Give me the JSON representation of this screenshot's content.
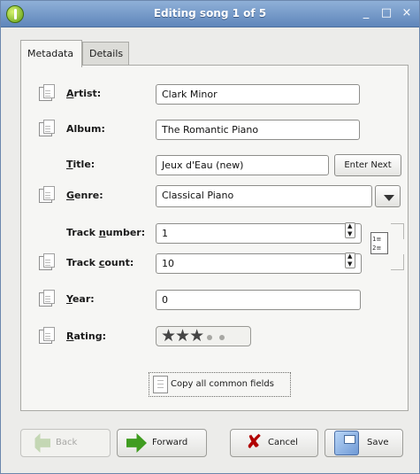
{
  "window": {
    "title": "Editing song 1 of 5",
    "buttons": [
      "_",
      "□",
      "×"
    ]
  },
  "tabs": [
    {
      "label": "Metadata",
      "active": true
    },
    {
      "label": "Details",
      "active": false
    }
  ],
  "fields": {
    "artist": {
      "label": "Artist:",
      "value": "Clark Minor"
    },
    "album": {
      "label": "Album:",
      "value": "The Romantic Piano"
    },
    "title": {
      "label": "Title:",
      "value": "Jeux d'Eau (new)",
      "button": "Enter Next"
    },
    "genre": {
      "label": "Genre:",
      "value": "Classical Piano"
    },
    "track_number": {
      "label": "Track number:",
      "value": "1"
    },
    "track_count": {
      "label": "Track count:",
      "value": "10"
    },
    "year": {
      "label": "Year:",
      "value": "0"
    },
    "rating": {
      "label": "Rating:",
      "value": 3,
      "max": 5
    }
  },
  "copy_button": "Copy all common fields",
  "buttons": {
    "back": "Back",
    "forward": "Forward",
    "cancel": "Cancel",
    "save": "Save"
  },
  "icons": {
    "app": "app-icon",
    "field": "document-icon",
    "sequence": "sequence-icon",
    "back": "back-arrow-icon",
    "forward": "forward-arrow-icon",
    "cancel": "cancel-icon",
    "save": "save-icon"
  },
  "colors": {
    "titlebar": "#5f86bb",
    "accent_green": "#3f9c20",
    "cancel_red": "#b10000"
  }
}
